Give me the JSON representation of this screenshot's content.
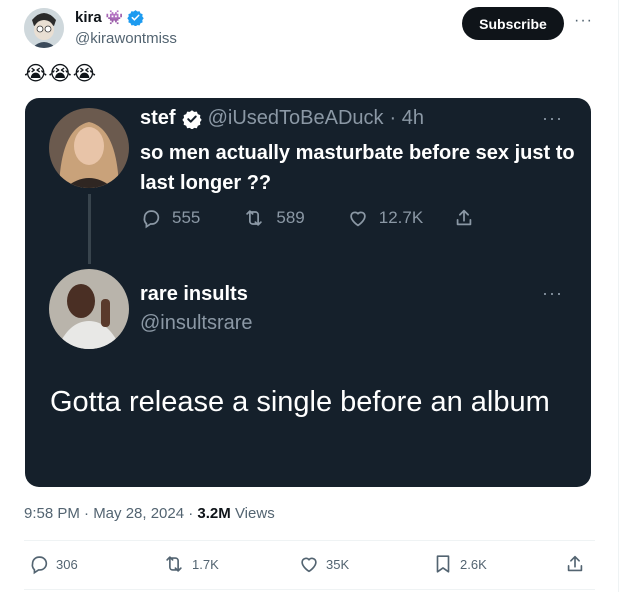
{
  "tweet": {
    "display_name": "kira",
    "name_emoji": "👾",
    "handle": "@kirawontmiss",
    "subscribe_label": "Subscribe",
    "more_label": "···",
    "text": "😭😭😭",
    "timestamp": "9:58 PM · May 28, 2024 · ",
    "views_count": "3.2M",
    "views_label": " Views"
  },
  "media": {
    "original": {
      "name": "stef",
      "handle": "@iUsedToBeADuck",
      "time": "· 4h",
      "more_label": "···",
      "text": "so men actually masturbate before sex just to last longer ??",
      "stats": {
        "replies": "555",
        "reposts": "589",
        "likes": "12.7K"
      }
    },
    "reply": {
      "name": "rare insults",
      "handle": "@insultsrare",
      "more_label": "···",
      "text": "Gotta release a single before an album"
    }
  },
  "actions": {
    "replies": "306",
    "reposts": "1.7K",
    "likes": "35K",
    "bookmarks": "2.6K"
  },
  "colors": {
    "verified": "#1d9bf0",
    "dark_bg": "#15202b",
    "muted": "#536471",
    "subscribe_bg": "#0f1419"
  }
}
